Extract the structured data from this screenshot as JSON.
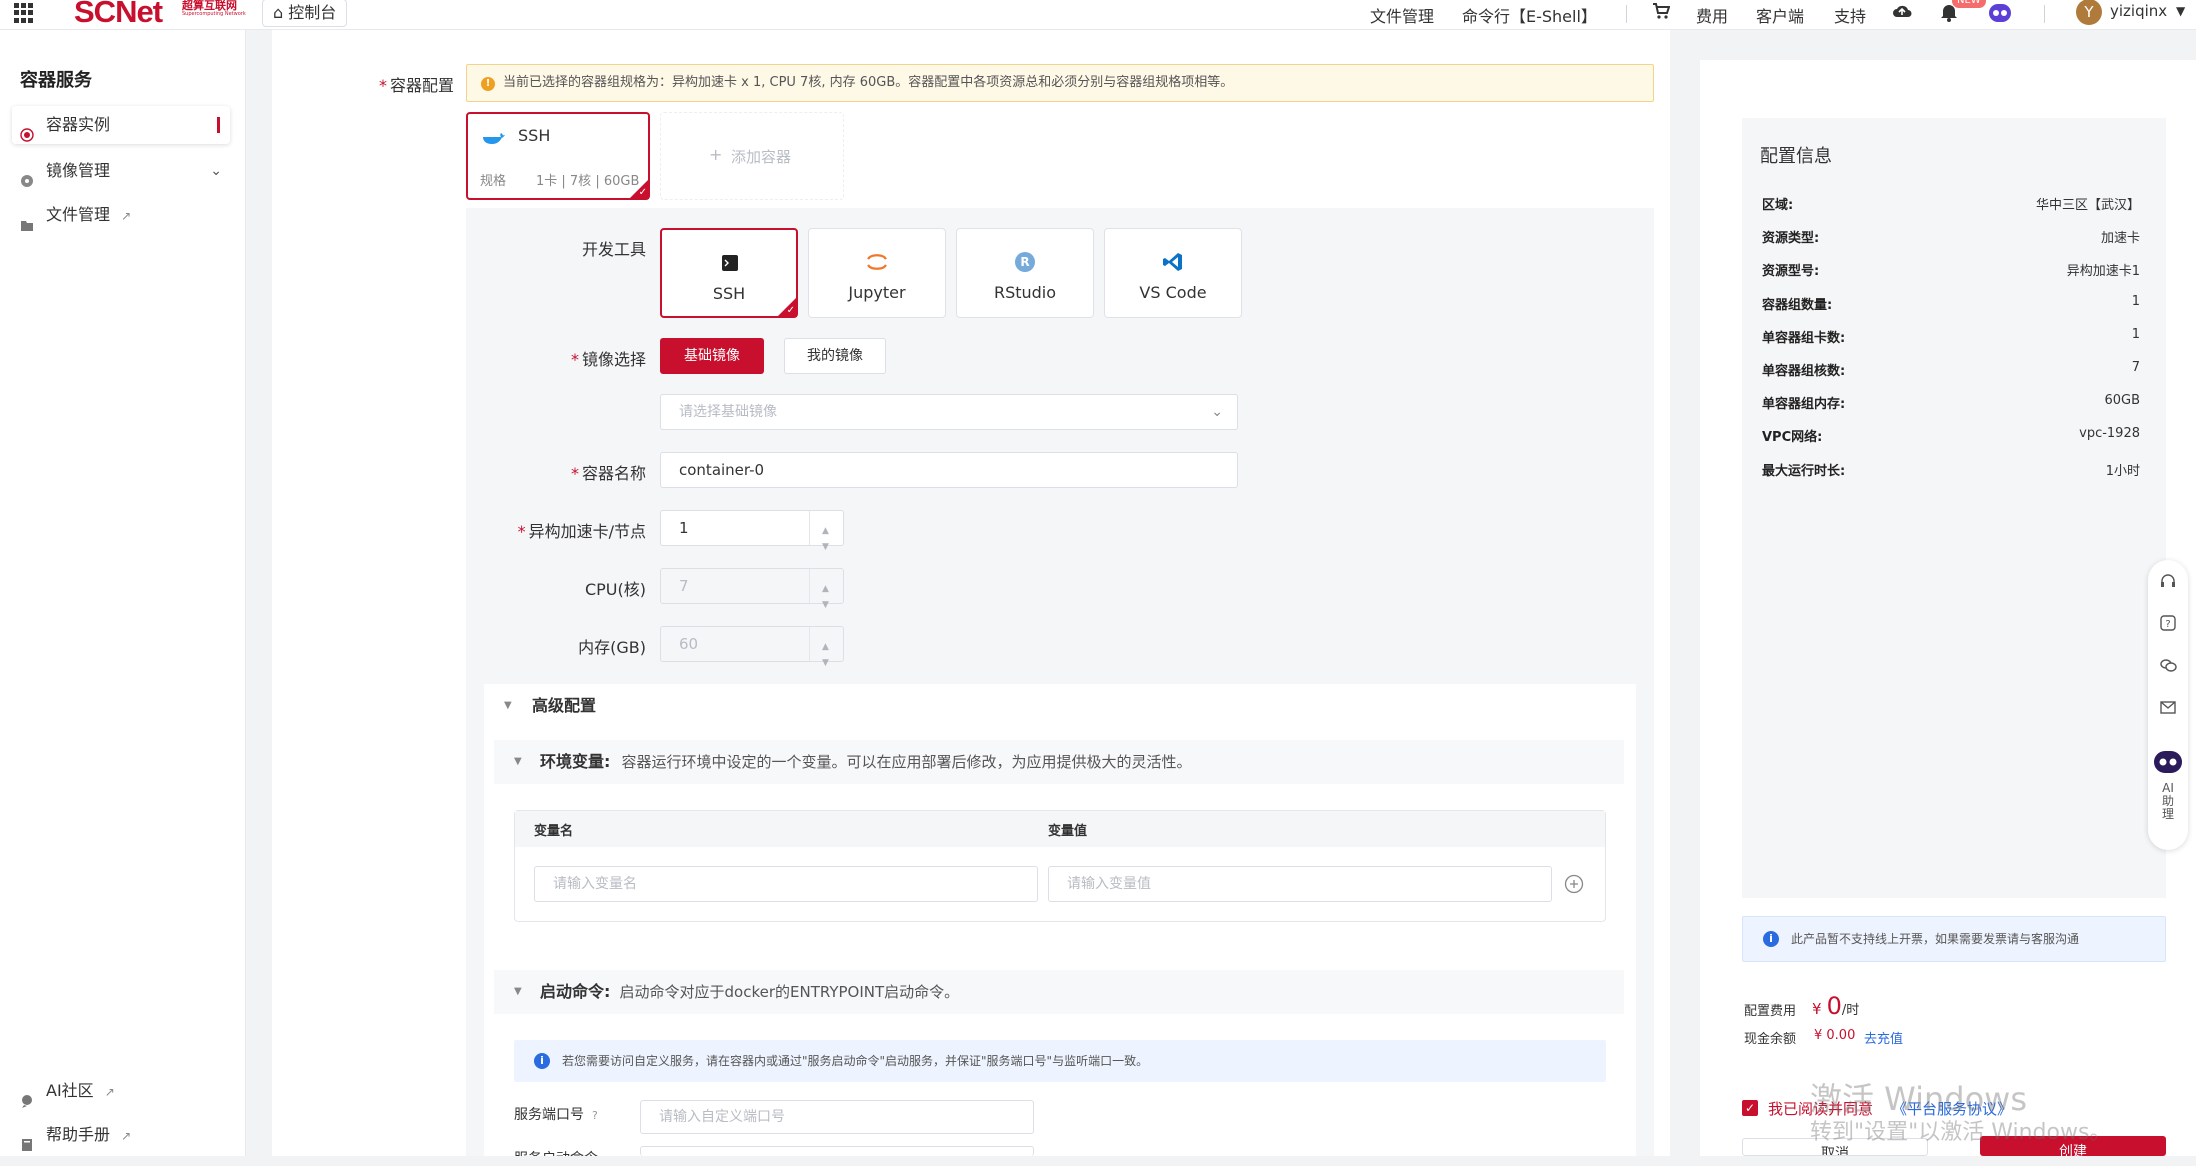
{
  "topbar": {
    "logo": "SCNet",
    "logo_sub_1": "超算互联网",
    "logo_sub_2": "Supercomputing Network",
    "console": "控制台",
    "nav": [
      "文件管理",
      "命令行【E-Shell】",
      "费用",
      "客户端",
      "支持"
    ],
    "badge": "NEW",
    "avatar_letter": "Y",
    "username": "yiziqinx"
  },
  "sidebar": {
    "title": "容器服务",
    "items": [
      {
        "label": "容器实例"
      },
      {
        "label": "镜像管理"
      },
      {
        "label": "文件管理"
      }
    ],
    "bottom": [
      {
        "label": "AI社区"
      },
      {
        "label": "帮助手册"
      }
    ]
  },
  "main": {
    "container_config_label": "容器配置",
    "notice": "当前已选择的容器组规格为：异构加速卡 x 1, CPU 7核, 内存 60GB。容器配置中各项资源总和必须分别与容器组规格项相等。",
    "container_card": {
      "name": "SSH",
      "spec_label": "规格",
      "spec_value": "1卡 | 7核 | 60GB"
    },
    "add_container": "添加容器",
    "dev_tools_label": "开发工具",
    "tools": [
      "SSH",
      "Jupyter",
      "RStudio",
      "VS Code"
    ],
    "image_label": "镜像选择",
    "image_tabs": [
      "基础镜像",
      "我的镜像"
    ],
    "image_placeholder": "请选择基础镜像",
    "name_label": "容器名称",
    "name_value": "container-0",
    "accel_label": "异构加速卡/节点",
    "accel_value": "1",
    "cpu_label": "CPU(核)",
    "cpu_value": "7",
    "mem_label": "内存(GB)",
    "mem_value": "60",
    "advanced": "高级配置",
    "env": {
      "title": "环境变量:",
      "desc": "容器运行环境中设定的一个变量。可以在应用部署后修改，为应用提供极大的灵活性。",
      "col_name": "变量名",
      "col_value": "变量值",
      "name_ph": "请输入变量名",
      "value_ph": "请输入变量值"
    },
    "startup": {
      "title": "启动命令:",
      "desc": "启动命令对应于docker的ENTRYPOINT启动命令。",
      "info": "若您需要访问自定义服务，请在容器内或通过\"服务启动命令\"启动服务，并保证\"服务端口号\"与监听端口一致。",
      "port_label": "服务端口号",
      "port_ph": "请输入自定义端口号",
      "cmd_label": "服务启动命令"
    }
  },
  "right": {
    "title": "配置信息",
    "rows": [
      {
        "k": "区域:",
        "v": "华中三区【武汉】"
      },
      {
        "k": "资源类型:",
        "v": "加速卡"
      },
      {
        "k": "资源型号:",
        "v": "异构加速卡1"
      },
      {
        "k": "容器组数量:",
        "v": "1"
      },
      {
        "k": "单容器组卡数:",
        "v": "1"
      },
      {
        "k": "单容器组核数:",
        "v": "7"
      },
      {
        "k": "单容器组内存:",
        "v": "60GB"
      },
      {
        "k": "VPC网络:",
        "v": "vpc-1928"
      },
      {
        "k": "最大运行时长:",
        "v": "1小时"
      }
    ],
    "info": "此产品暂不支持线上开票，如果需要发票请与客服沟通",
    "fee_label": "配置费用",
    "fee_currency": "¥",
    "fee_value": "0",
    "fee_unit": "/时",
    "balance_label": "现金余额",
    "balance_value": "¥ 0.00",
    "recharge": "去充值",
    "agree_text": "我已阅读并同意",
    "agree_link": "《平台服务协议》",
    "cancel": "取消",
    "create": "创建",
    "ai_assistant": "AI助理"
  },
  "watermark": {
    "line1": "激活 Windows",
    "line2": "转到\"设置\"以激活 Windows。"
  },
  "colors": {
    "accent": "#c8102e",
    "link": "#2a6be0"
  }
}
